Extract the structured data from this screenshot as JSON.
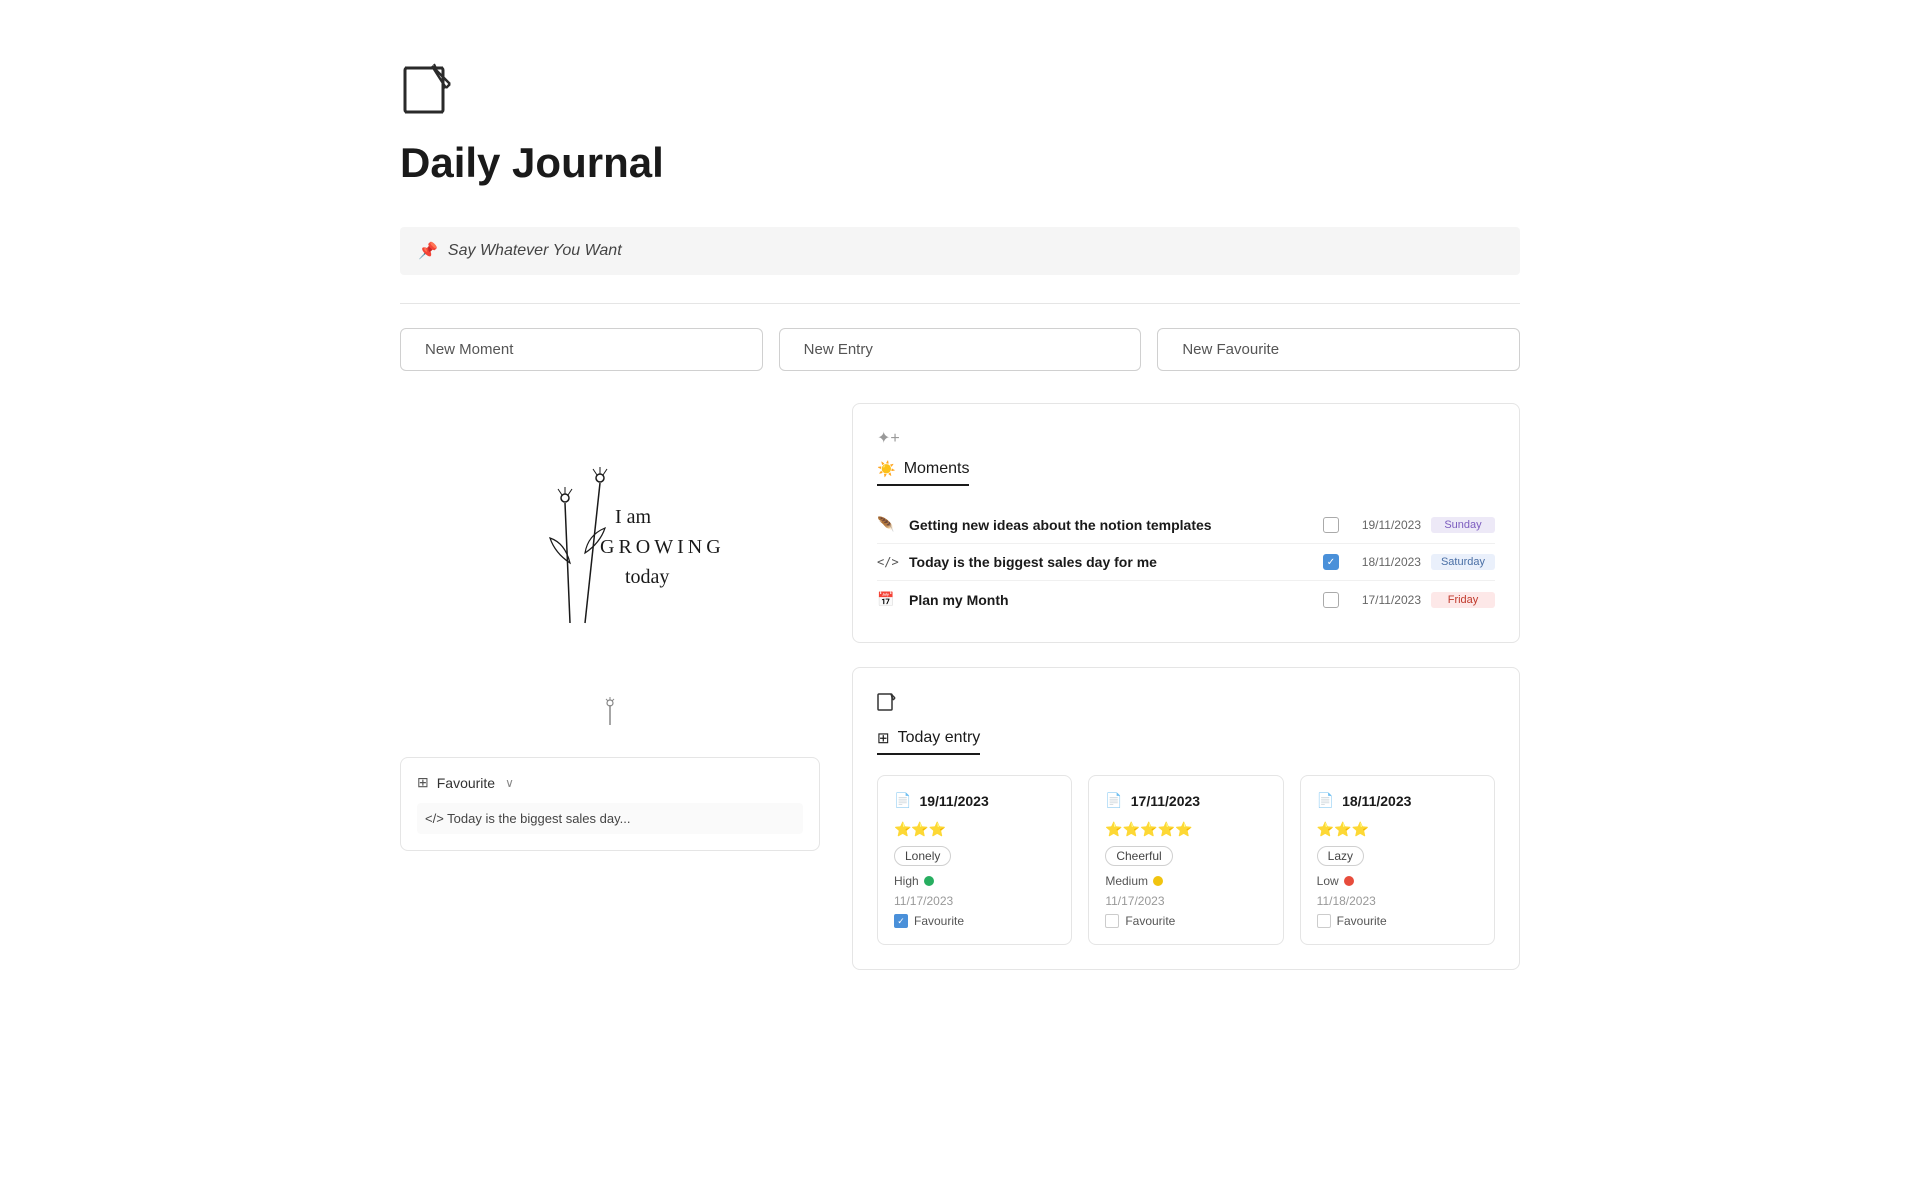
{
  "header": {
    "title": "Daily Journal"
  },
  "pinned": {
    "text": "Say Whatever You Want"
  },
  "buttons": {
    "new_moment": "New Moment",
    "new_entry": "New Entry",
    "new_favourite": "New Favourite"
  },
  "moments_card": {
    "tab_label": "Moments",
    "drag_icon": "✦",
    "items": [
      {
        "icon": "🪶",
        "text": "Getting new ideas about the notion templates",
        "checked": false,
        "date": "19/11/2023",
        "day": "Sunday",
        "day_class": "day-sunday"
      },
      {
        "icon": "</>",
        "text": "Today is the biggest sales day for me",
        "checked": true,
        "date": "18/11/2023",
        "day": "Saturday",
        "day_class": "day-saturday"
      },
      {
        "icon": "📅",
        "text": "Plan my Month",
        "checked": false,
        "date": "17/11/2023",
        "day": "Friday",
        "day_class": "day-friday"
      }
    ]
  },
  "today_entry_card": {
    "tab_label": "Today entry",
    "entries": [
      {
        "date": "19/11/2023",
        "stars": "⭐⭐⭐",
        "mood_tag": "Lonely",
        "energy": "High",
        "energy_color": "mood-green",
        "entry_date": "11/17/2023",
        "favourite": true,
        "favourite_label": "Favourite"
      },
      {
        "date": "17/11/2023",
        "stars": "⭐⭐⭐⭐⭐",
        "mood_tag": "Cheerful",
        "energy": "Medium",
        "energy_color": "mood-yellow",
        "entry_date": "11/17/2023",
        "favourite": false,
        "favourite_label": "Favourite"
      },
      {
        "date": "18/11/2023",
        "stars": "⭐⭐⭐",
        "mood_tag": "Lazy",
        "energy": "Low",
        "energy_color": "mood-red",
        "entry_date": "11/18/2023",
        "favourite": false,
        "favourite_label": "Favourite"
      }
    ]
  },
  "favourite_card": {
    "title": "Favourite",
    "preview_text": "</> Today is the biggest sales day..."
  },
  "plant_handwriting": {
    "line1": "I am",
    "line2": "GROWING",
    "line3": "today"
  }
}
